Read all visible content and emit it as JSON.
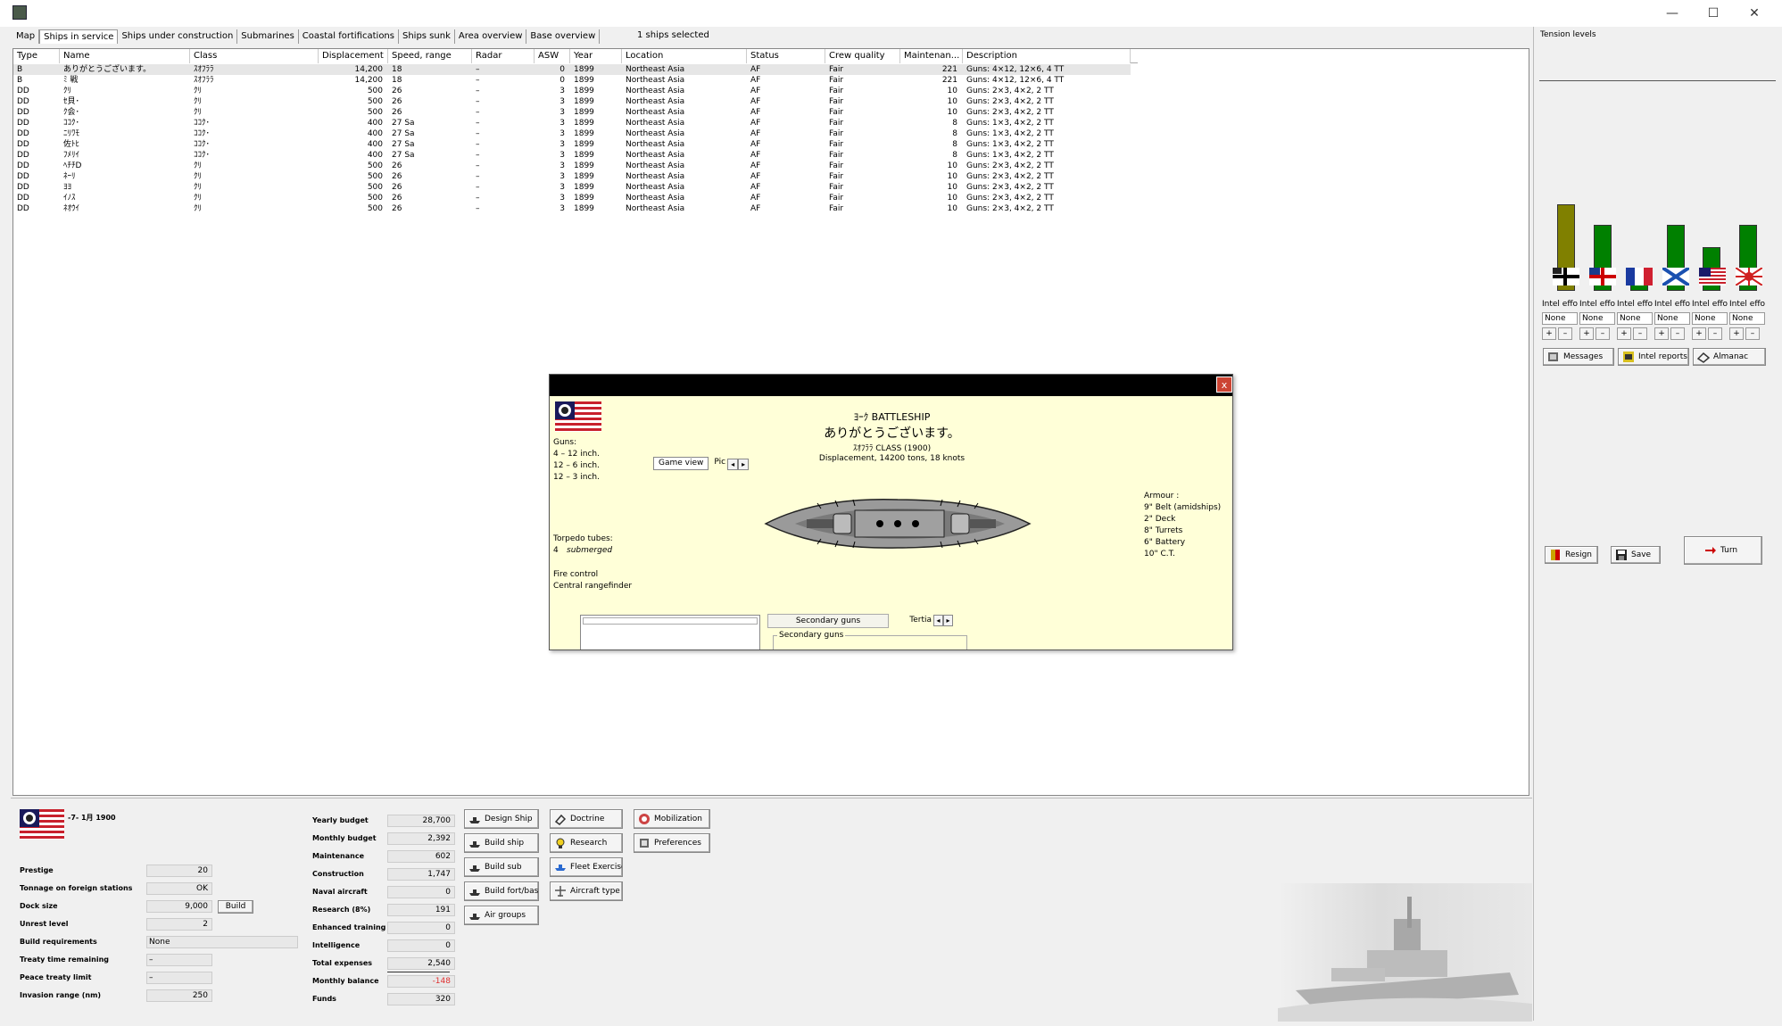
{
  "window": {
    "minimize": "—",
    "maximize": "☐",
    "close": "✕"
  },
  "tabs": [
    "Map",
    "Ships in service",
    "Ships under construction",
    "Submarines",
    "Coastal fortifications",
    "Ships sunk",
    "Area overview",
    "Base overview"
  ],
  "selection_text": "1 ships selected",
  "columns": [
    "Type",
    "Name",
    "Class",
    "Displacement",
    "Speed, range",
    "Radar",
    "ASW",
    "Year",
    "Location",
    "Status",
    "Crew quality",
    "Maintenan...",
    "Description"
  ],
  "ships": [
    [
      "B",
      "ありがとうございます。",
      "ｽｵﾌﾗﾗ",
      "14,200",
      "18",
      "–",
      "0",
      "1899",
      "Northeast Asia",
      "AF",
      "Fair",
      "221",
      "Guns: 4×12, 12×6, 4 TT"
    ],
    [
      "B",
      "ﾐ 戦",
      "ｽｵﾌﾗﾗ",
      "14,200",
      "18",
      "–",
      "0",
      "1899",
      "Northeast Asia",
      "AF",
      "Fair",
      "221",
      "Guns: 4×12, 12×6, 4 TT"
    ],
    [
      "DD",
      "ｸﾘ",
      "ｸﾘ",
      "500",
      "26",
      "–",
      "3",
      "1899",
      "Northeast Asia",
      "AF",
      "Fair",
      "10",
      "Guns: 2×3, 4×2, 2 TT"
    ],
    [
      "DD",
      "ｾ貝･",
      "ｸﾘ",
      "500",
      "26",
      "–",
      "3",
      "1899",
      "Northeast Asia",
      "AF",
      "Fair",
      "10",
      "Guns: 2×3, 4×2, 2 TT"
    ],
    [
      "DD",
      "ｸ会･",
      "ｸﾘ",
      "500",
      "26",
      "–",
      "3",
      "1899",
      "Northeast Asia",
      "AF",
      "Fair",
      "10",
      "Guns: 2×3, 4×2, 2 TT"
    ],
    [
      "DD",
      "ｺｺｸ･",
      "ｺｺｸ･",
      "400",
      "27 Sa",
      "–",
      "3",
      "1899",
      "Northeast Asia",
      "AF",
      "Fair",
      "8",
      "Guns: 1×3, 4×2, 2 TT"
    ],
    [
      "DD",
      "ﾆﾘﾜﾓ",
      "ｺｺｸ･",
      "400",
      "27 Sa",
      "–",
      "3",
      "1899",
      "Northeast Asia",
      "AF",
      "Fair",
      "8",
      "Guns: 1×3, 4×2, 2 TT"
    ],
    [
      "DD",
      "佐ﾄﾋ",
      "ｺｺｸ･",
      "400",
      "27 Sa",
      "–",
      "3",
      "1899",
      "Northeast Asia",
      "AF",
      "Fair",
      "8",
      "Guns: 1×3, 4×2, 2 TT"
    ],
    [
      "DD",
      "ﾌﾒﾘｲ",
      "ｺｺｸ･",
      "400",
      "27 Sa",
      "–",
      "3",
      "1899",
      "Northeast Asia",
      "AF",
      "Fair",
      "8",
      "Guns: 1×3, 4×2, 2 TT"
    ],
    [
      "DD",
      "ﾍﾁﾁD",
      "ｸﾘ",
      "500",
      "26",
      "–",
      "3",
      "1899",
      "Northeast Asia",
      "AF",
      "Fair",
      "10",
      "Guns: 2×3, 4×2, 2 TT"
    ],
    [
      "DD",
      "ﾈｰﾘ",
      "ｸﾘ",
      "500",
      "26",
      "–",
      "3",
      "1899",
      "Northeast Asia",
      "AF",
      "Fair",
      "10",
      "Guns: 2×3, 4×2, 2 TT"
    ],
    [
      "DD",
      "ﾖﾖ",
      "ｸﾘ",
      "500",
      "26",
      "–",
      "3",
      "1899",
      "Northeast Asia",
      "AF",
      "Fair",
      "10",
      "Guns: 2×3, 4×2, 2 TT"
    ],
    [
      "DD",
      "ｲﾉｽ",
      "ｸﾘ",
      "500",
      "26",
      "–",
      "3",
      "1899",
      "Northeast Asia",
      "AF",
      "Fair",
      "10",
      "Guns: 2×3, 4×2, 2 TT"
    ],
    [
      "DD",
      "ﾈｵｳｲ",
      "ｸﾘ",
      "500",
      "26",
      "–",
      "3",
      "1899",
      "Northeast Asia",
      "AF",
      "Fair",
      "10",
      "Guns: 2×3, 4×2, 2 TT"
    ]
  ],
  "dialog": {
    "close": "x",
    "type_line": "ﾖｰｸ BATTLESHIP",
    "ship_name": "ありがとうございます。",
    "class_line": "ｽｵﾌﾗﾗ CLASS (1900)",
    "displacement_line": "Displacement, 14200 tons, 18 knots",
    "guns_title": "Guns:",
    "guns": [
      "4 – 12 inch.",
      "12 – 6 inch.",
      "12 – 3 inch."
    ],
    "torpedo_title": "Torpedo tubes:",
    "torpedo_value": "4",
    "torpedo_type": "submerged",
    "fire_control_title": "Fire control",
    "fire_control_value": "Central rangefinder",
    "tab_game_view": "Game view",
    "tab_pic": "Pic",
    "armour_title": "Armour :",
    "armour": [
      "9\" Belt (amidships)",
      "2\" Deck",
      "8\" Turrets",
      "6\" Battery",
      "10\" C.T."
    ],
    "tab_secondary": "Secondary guns",
    "tab_tertiary": "Tertia",
    "group_secondary": "Secondary guns"
  },
  "bottom": {
    "date": "-7- 1月 1900",
    "left_labels": [
      "Prestige",
      "Tonnage on foreign stations",
      "Dock size",
      "Unrest level",
      "Build requirements",
      "Treaty time remaining",
      "Peace treaty limit",
      "Invasion range (nm)"
    ],
    "left_values": [
      "20",
      "OK",
      "9,000",
      "2",
      "None",
      "–",
      "–",
      "250"
    ],
    "dock_build_label": "Build",
    "budget_labels": [
      "Yearly budget",
      "Monthly budget",
      "Maintenance",
      "Construction",
      "Naval aircraft",
      "Research (8%)",
      "Enhanced training",
      "Intelligence",
      "Total expenses",
      "Monthly balance",
      "Funds"
    ],
    "budget_values": [
      "28,700",
      "2,392",
      "602",
      "1,747",
      "0",
      "191",
      "0",
      "0",
      "2,540",
      "-148",
      "320"
    ],
    "buttons_col1": [
      "Design Ship",
      "Build ship",
      "Build sub",
      "Build fort/base",
      "Air groups"
    ],
    "buttons_col2": [
      "Doctrine",
      "Research",
      "Fleet Exercise",
      "Aircraft type"
    ],
    "buttons_col3": [
      "Mobilization",
      "Preferences"
    ]
  },
  "right": {
    "tension_title": "Tension levels",
    "tension_levels": [
      0.69,
      0.53,
      0.18,
      0.53,
      0.35,
      0.53
    ],
    "bar_colors": [
      "#808000",
      "#008000",
      "#008000",
      "#008000",
      "#008000",
      "#008000"
    ],
    "nations": [
      "germany-flag-icon",
      "britain-flag-icon",
      "france-flag-icon",
      "russia-flag-icon",
      "usa-flag-icon",
      "japan-flag-icon"
    ],
    "intel_label": "Intel effo",
    "intel_values": [
      "None",
      "None",
      "None",
      "None",
      "None",
      "None"
    ],
    "plus": "+",
    "minus": "–",
    "btn_messages": "Messages",
    "btn_intel": "Intel reports",
    "btn_almanac": "Almanac",
    "btn_resign": "Resign",
    "btn_save": "Save",
    "btn_turn": "Turn"
  },
  "colors": {
    "dialog_bg": "#ffffd8",
    "negative": "#e03030"
  }
}
